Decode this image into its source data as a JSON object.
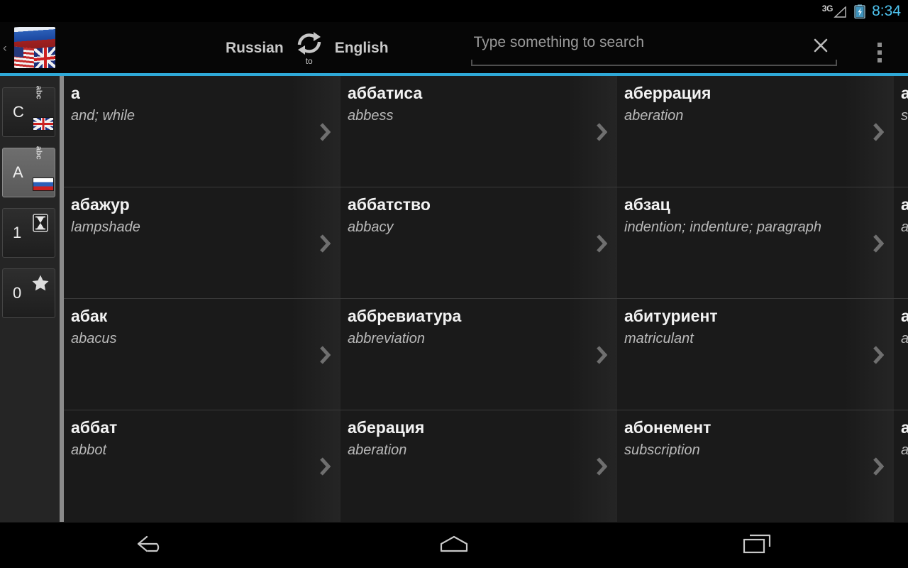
{
  "status_bar": {
    "network": "3G",
    "time": "8:34",
    "battery_icon": "battery-charging-icon",
    "signal_icon": "signal-3g-icon",
    "accent_color": "#4ec3ef"
  },
  "action_bar": {
    "app_icon": "app-flags-icon",
    "back_caret": "‹",
    "source_language": "Russian",
    "target_language": "English",
    "swap_icon": "swap-languages-icon",
    "swap_label": "to",
    "search": {
      "value": "",
      "placeholder": "Type something to search",
      "clear_icon": "clear-x-icon"
    },
    "overflow_icon": "overflow-menu-icon",
    "accent_color": "#2fa9d8"
  },
  "sidebar": {
    "tabs": [
      {
        "count": "C",
        "icon": "abc-uk-flag-icon",
        "abc_text": "abc",
        "flag": "uk",
        "selected": false,
        "name": "sidebar-tab-english-dictionary"
      },
      {
        "count": "A",
        "icon": "abc-ru-flag-icon",
        "abc_text": "abc",
        "flag": "ru",
        "selected": true,
        "name": "sidebar-tab-russian-dictionary"
      },
      {
        "count": "1",
        "icon": "hourglass-history-icon",
        "abc_text": "",
        "flag": "",
        "selected": false,
        "name": "sidebar-tab-history"
      },
      {
        "count": "0",
        "icon": "star-favorites-icon",
        "abc_text": "",
        "flag": "",
        "selected": false,
        "name": "sidebar-tab-favorites"
      }
    ]
  },
  "entries": {
    "chevron_icon": "chevron-right-icon",
    "rows": [
      [
        {
          "word": "а",
          "translation": "and; while"
        },
        {
          "word": "аббатиса",
          "translation": "abbess"
        },
        {
          "word": "аберрация",
          "translation": "aberation"
        },
        {
          "word": "а",
          "translation": "s"
        }
      ],
      [
        {
          "word": "абажур",
          "translation": "lampshade"
        },
        {
          "word": "аббатство",
          "translation": "abbacy"
        },
        {
          "word": "абзац",
          "translation": "indention; indenture; paragraph"
        },
        {
          "word": "а",
          "translation": "a"
        }
      ],
      [
        {
          "word": "абак",
          "translation": "abacus"
        },
        {
          "word": "аббревиатура",
          "translation": "abbreviation"
        },
        {
          "word": "абитуриент",
          "translation": "matriculant"
        },
        {
          "word": "а",
          "translation": "a"
        }
      ],
      [
        {
          "word": "аббат",
          "translation": "abbot"
        },
        {
          "word": "аберация",
          "translation": "aberation"
        },
        {
          "word": "абонемент",
          "translation": "subscription"
        },
        {
          "word": "а",
          "translation": "a"
        }
      ]
    ]
  },
  "nav_bar": {
    "back_icon": "back-arrow-icon",
    "home_icon": "home-icon",
    "recents_icon": "recent-apps-icon"
  }
}
